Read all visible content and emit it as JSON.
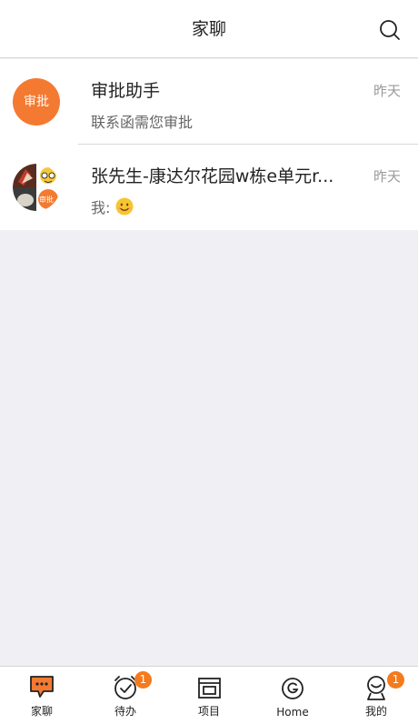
{
  "header": {
    "title": "家聊",
    "search_icon": "search-icon"
  },
  "conversations": [
    {
      "avatar_text": "审批",
      "title": "审批助手",
      "time": "昨天",
      "subtitle": "联系函需您审批"
    },
    {
      "avatar_badge": "审批",
      "title": "张先生-康达尔花园w栋e单元r...",
      "time": "昨天",
      "subtitle_prefix": "我:",
      "emoji": "smiling-face"
    }
  ],
  "tabs": [
    {
      "label": "家聊",
      "icon": "chat-icon",
      "active": true
    },
    {
      "label": "待办",
      "icon": "clock-check-icon",
      "badge": "1"
    },
    {
      "label": "项目",
      "icon": "window-icon"
    },
    {
      "label": "Home",
      "icon": "home-swirl-icon"
    },
    {
      "label": "我的",
      "icon": "profile-icon",
      "badge": "1"
    }
  ],
  "colors": {
    "accent": "#f47a31",
    "badge": "#f47a1e",
    "background": "#efeff4"
  }
}
